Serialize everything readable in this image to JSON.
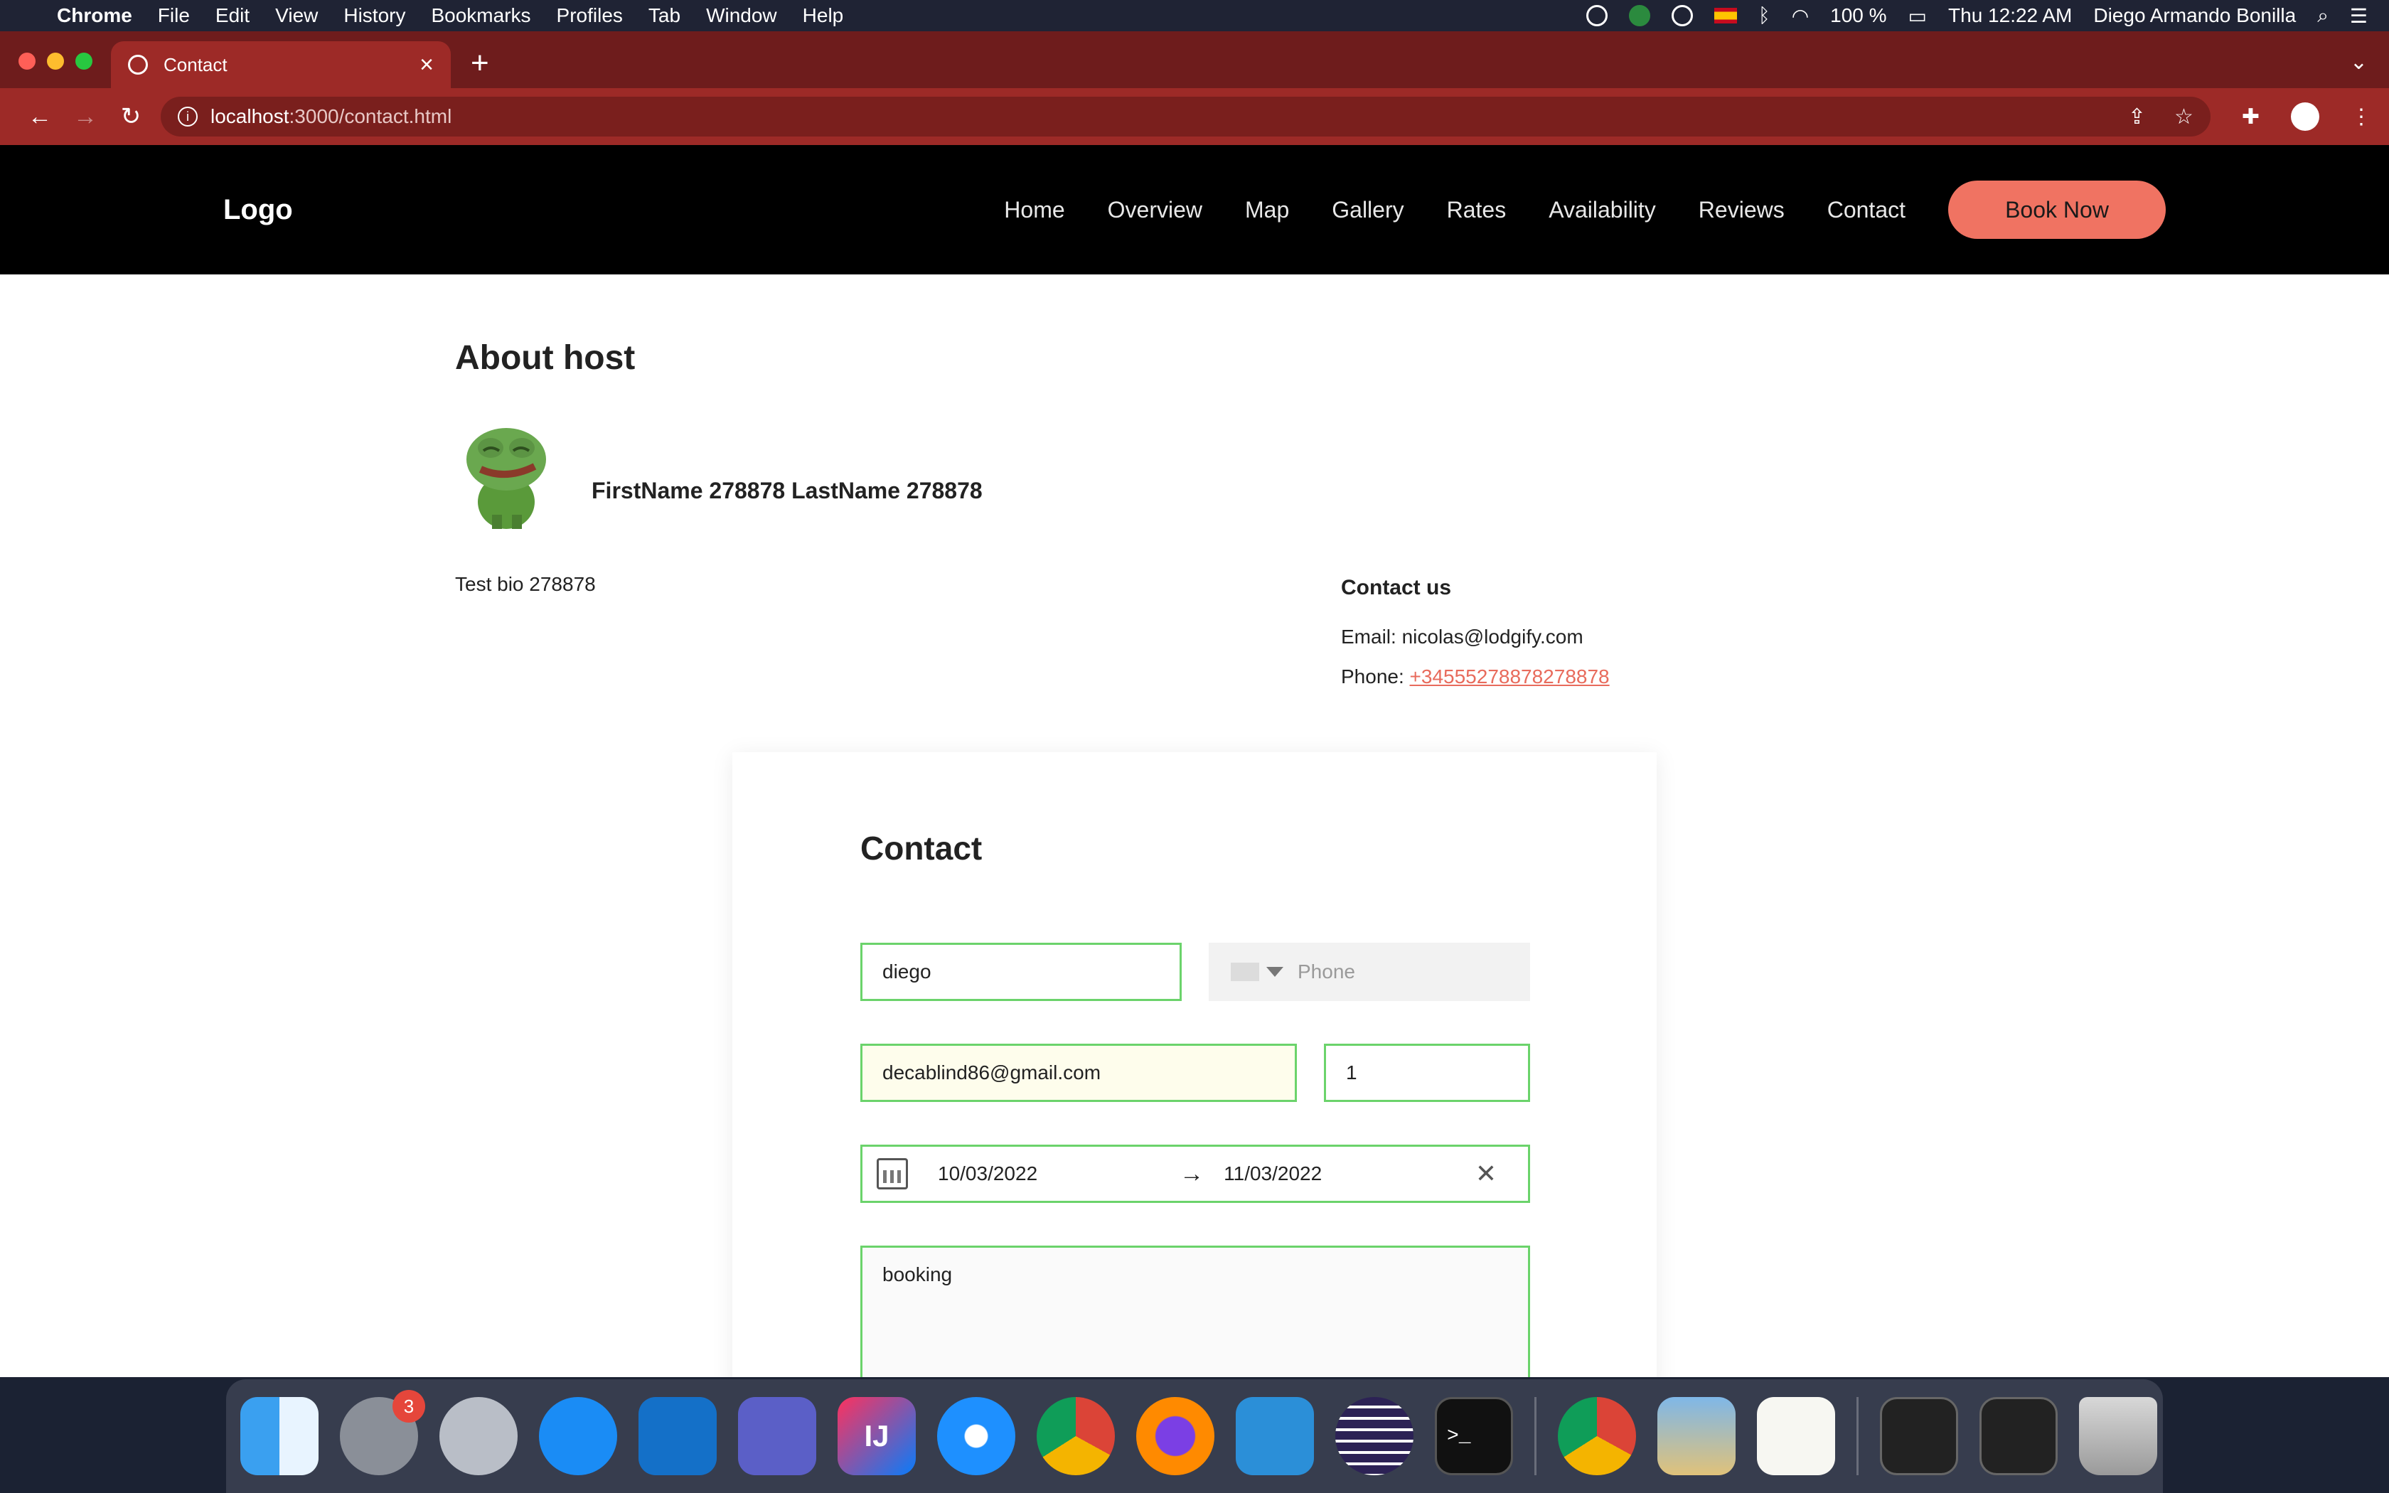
{
  "menubar": {
    "app_name": "Chrome",
    "menus": [
      "File",
      "Edit",
      "View",
      "History",
      "Bookmarks",
      "Profiles",
      "Tab",
      "Window",
      "Help"
    ],
    "battery": "100 %",
    "clock": "Thu 12:22 AM",
    "user": "Diego Armando Bonilla"
  },
  "browser": {
    "tab_title": "Contact",
    "url_host": "localhost",
    "url_path": ":3000/contact.html"
  },
  "site": {
    "logo": "Logo",
    "nav": [
      "Home",
      "Overview",
      "Map",
      "Gallery",
      "Rates",
      "Availability",
      "Reviews",
      "Contact"
    ],
    "book_now": "Book Now",
    "accent_color": "#f07362"
  },
  "about": {
    "title": "About host",
    "host_name": "FirstName 278878 LastName 278878",
    "bio": "Test bio 278878"
  },
  "contact_info": {
    "title": "Contact us",
    "email_label": "Email: ",
    "email": "nicolas@lodgify.com",
    "phone_label": "Phone: ",
    "phone": "+34555278878278878"
  },
  "form": {
    "title": "Contact",
    "name_value": "diego",
    "phone_placeholder": "Phone",
    "email_value": "decablind86@gmail.com",
    "guests_value": "1",
    "date_from": "10/03/2022",
    "date_to": "11/03/2022",
    "message_value": "booking"
  },
  "dock": {
    "apps": [
      "finder-icon",
      "system-preferences-icon",
      "launchpad-icon",
      "app-store-icon",
      "outlook-icon",
      "teams-icon",
      "intellij-icon",
      "safari-icon",
      "chrome-icon",
      "firefox-icon",
      "vscode-icon",
      "eclipse-icon",
      "terminal-icon",
      "chrome-icon",
      "preview-icon",
      "textedit-icon",
      "window-thumbnail-icon",
      "window-thumbnail-icon",
      "trash-icon"
    ],
    "system_prefs_badge": "3"
  }
}
